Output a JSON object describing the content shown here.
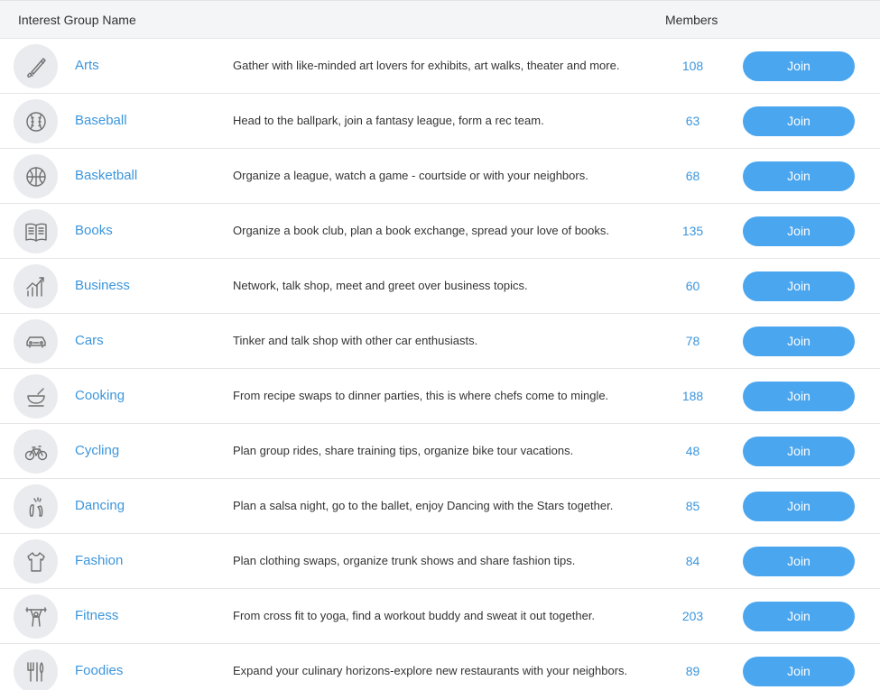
{
  "header": {
    "name_col": "Interest Group Name",
    "members_col": "Members"
  },
  "accent": "#4aa6ef",
  "link_color": "#3c96dc",
  "groups": [
    {
      "icon": "paintbrush-icon",
      "name": "Arts",
      "description": "Gather with like-minded art lovers for exhibits, art walks, theater and more.",
      "members": "108",
      "button": "Join"
    },
    {
      "icon": "baseball-icon",
      "name": "Baseball",
      "description": "Head to the ballpark, join a fantasy league, form a rec team.",
      "members": "63",
      "button": "Join"
    },
    {
      "icon": "basketball-icon",
      "name": "Basketball",
      "description": "Organize a league, watch a game - courtside or with your neighbors.",
      "members": "68",
      "button": "Join"
    },
    {
      "icon": "book-icon",
      "name": "Books",
      "description": "Organize a book club, plan a book exchange, spread your love of books.",
      "members": "135",
      "button": "Join"
    },
    {
      "icon": "bar-chart-icon",
      "name": "Business",
      "description": "Network, talk shop, meet and greet over business topics.",
      "members": "60",
      "button": "Join"
    },
    {
      "icon": "car-icon",
      "name": "Cars",
      "description": "Tinker and talk shop with other car enthusiasts.",
      "members": "78",
      "button": "Join"
    },
    {
      "icon": "bowl-icon",
      "name": "Cooking",
      "description": "From recipe swaps to dinner parties, this is where chefs come to mingle.",
      "members": "188",
      "button": "Join"
    },
    {
      "icon": "bicycle-icon",
      "name": "Cycling",
      "description": "Plan group rides, share training tips, organize bike tour vacations.",
      "members": "48",
      "button": "Join"
    },
    {
      "icon": "dance-shoes-icon",
      "name": "Dancing",
      "description": "Plan a salsa night, go to the ballet, enjoy Dancing with the Stars together.",
      "members": "85",
      "button": "Join"
    },
    {
      "icon": "shirt-icon",
      "name": "Fashion",
      "description": "Plan clothing swaps, organize trunk shows and share fashion tips.",
      "members": "84",
      "button": "Join"
    },
    {
      "icon": "weightlifter-icon",
      "name": "Fitness",
      "description": "From cross fit to yoga, find a workout buddy and sweat it out together.",
      "members": "203",
      "button": "Join"
    },
    {
      "icon": "cutlery-icon",
      "name": "Foodies",
      "description": "Expand your culinary horizons-explore new restaurants with your neighbors.",
      "members": "89",
      "button": "Join"
    }
  ]
}
